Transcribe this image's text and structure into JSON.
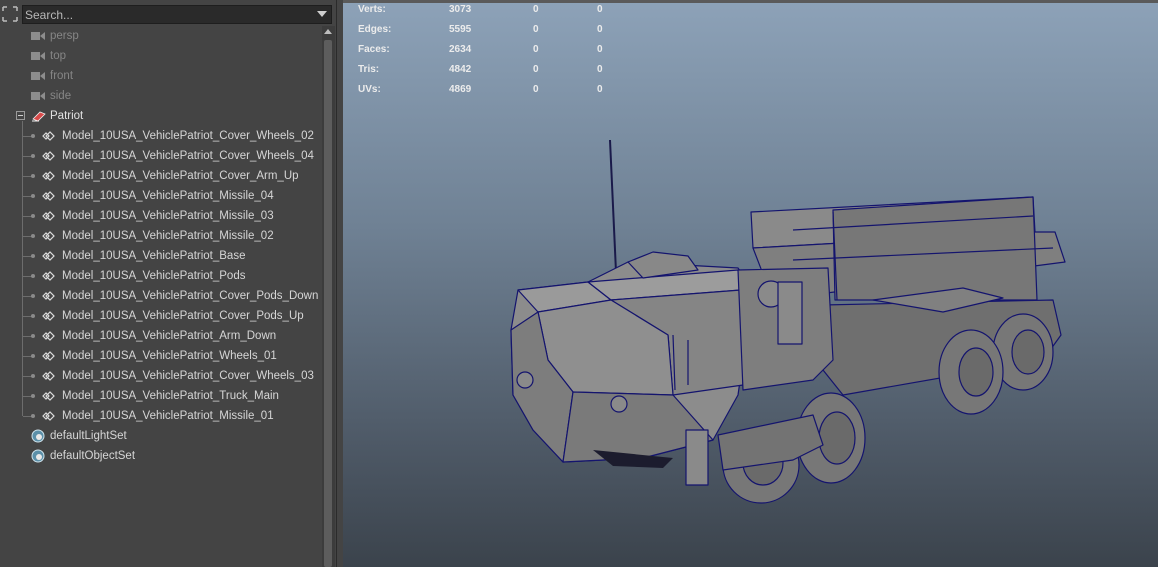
{
  "outliner": {
    "search_placeholder": "Search...",
    "cameras": [
      {
        "label": "persp"
      },
      {
        "label": "top"
      },
      {
        "label": "front"
      },
      {
        "label": "side"
      }
    ],
    "group": {
      "label": "Patriot"
    },
    "children": [
      {
        "label": "Model_10USA_VehiclePatriot_Cover_Wheels_02"
      },
      {
        "label": "Model_10USA_VehiclePatriot_Cover_Wheels_04"
      },
      {
        "label": "Model_10USA_VehiclePatriot_Cover_Arm_Up"
      },
      {
        "label": "Model_10USA_VehiclePatriot_Missile_04"
      },
      {
        "label": "Model_10USA_VehiclePatriot_Missile_03"
      },
      {
        "label": "Model_10USA_VehiclePatriot_Missile_02"
      },
      {
        "label": "Model_10USA_VehiclePatriot_Base"
      },
      {
        "label": "Model_10USA_VehiclePatriot_Pods"
      },
      {
        "label": "Model_10USA_VehiclePatriot_Cover_Pods_Down"
      },
      {
        "label": "Model_10USA_VehiclePatriot_Cover_Pods_Up"
      },
      {
        "label": "Model_10USA_VehiclePatriot_Arm_Down"
      },
      {
        "label": "Model_10USA_VehiclePatriot_Wheels_01"
      },
      {
        "label": "Model_10USA_VehiclePatriot_Cover_Wheels_03"
      },
      {
        "label": "Model_10USA_VehiclePatriot_Truck_Main"
      },
      {
        "label": "Model_10USA_VehiclePatriot_Missile_01"
      }
    ],
    "sets": [
      {
        "label": "defaultLightSet"
      },
      {
        "label": "defaultObjectSet"
      }
    ]
  },
  "viewport": {
    "heads_up": [
      {
        "label": "Verts:",
        "values": [
          "3073",
          "0",
          "0"
        ]
      },
      {
        "label": "Edges:",
        "values": [
          "5595",
          "0",
          "0"
        ]
      },
      {
        "label": "Faces:",
        "values": [
          "2634",
          "0",
          "0"
        ]
      },
      {
        "label": "Tris:",
        "values": [
          "4842",
          "0",
          "0"
        ]
      },
      {
        "label": "UVs:",
        "values": [
          "4869",
          "0",
          "0"
        ]
      }
    ]
  },
  "colors": {
    "panel_bg": "#444444",
    "wireframe": "#14146e",
    "mesh_fill": "#8a8a8a",
    "viewport_top": "#8da2b8",
    "viewport_bottom": "#3b434c"
  }
}
